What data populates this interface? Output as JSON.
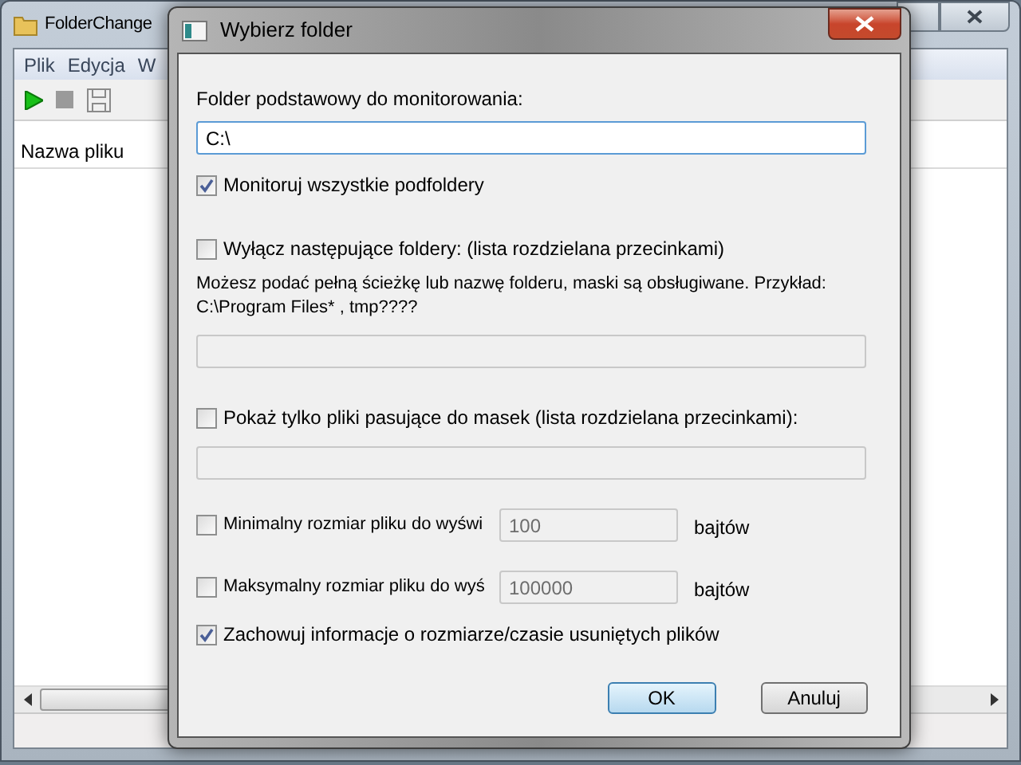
{
  "main_window": {
    "title": "FolderChange",
    "menu": [
      "Plik",
      "Edycja",
      "W"
    ],
    "list": {
      "columns": [
        "Nazwa pliku"
      ]
    }
  },
  "dialog": {
    "title": "Wybierz folder",
    "base_folder": {
      "label": "Folder podstawowy do monitorowania:",
      "value": "C:\\"
    },
    "options": [
      {
        "kind": "checkbox",
        "label": "Monitoruj wszystkie podfoldery",
        "checked": true
      },
      {
        "kind": "checkbox_field",
        "label": "Wyłącz następujące foldery: (lista rozdzielana przecinkami)",
        "checked": false,
        "hint_lines": [
          "Możesz podać pełną ścieżkę lub nazwę folderu, maski są obsługiwane. Przykład:",
          "C:\\Program Files* , tmp????"
        ],
        "field": {
          "disabled": true
        }
      },
      {
        "kind": "checkbox_field",
        "label": "Pokaż tylko pliki pasujące do masek (lista rozdzielana przecinkami):",
        "checked": false,
        "field": {
          "disabled": true
        }
      },
      {
        "kind": "size",
        "label": "Minimalny rozmiar pliku do wyświ",
        "checked": false,
        "value": "100",
        "unit": "bajtów",
        "disabled": true
      },
      {
        "kind": "size",
        "label": "Maksymalny rozmiar pliku do wyś",
        "checked": false,
        "value": "100000",
        "unit": "bajtów",
        "disabled": true
      },
      {
        "kind": "checkbox",
        "label": "Zachowuj informacje o rozmiarze/czasie usuniętych plików",
        "checked": true
      }
    ],
    "buttons": [
      {
        "label": "OK",
        "default": true
      },
      {
        "label": "Anuluj",
        "default": false
      }
    ]
  }
}
